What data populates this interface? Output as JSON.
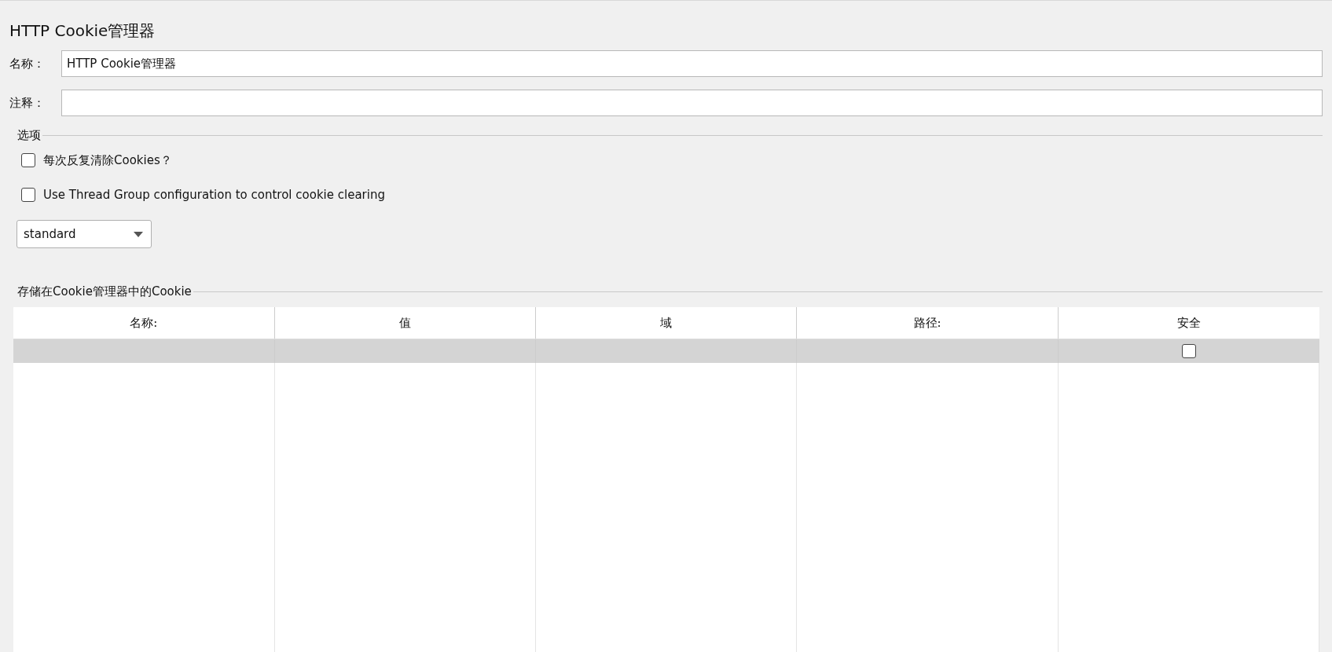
{
  "panel": {
    "title": "HTTP Cookie管理器"
  },
  "fields": [
    {
      "label": "名称：",
      "value": "HTTP Cookie管理器"
    },
    {
      "label": "注释："
    }
  ],
  "options": {
    "legend": "选项",
    "checkboxes": [
      {
        "label": "每次反复清除Cookies？",
        "checked": false
      },
      {
        "label": "Use Thread Group configuration to control cookie clearing",
        "checked": false
      }
    ],
    "policy": {
      "value": "standard"
    }
  },
  "cookies": {
    "legend": "存储在Cookie管理器中的Cookie",
    "table": {
      "columns": [
        "名称:",
        "值",
        "域",
        "路径:",
        "安全"
      ],
      "rows": [
        {
          "selected": true,
          "secure": false
        }
      ]
    }
  }
}
